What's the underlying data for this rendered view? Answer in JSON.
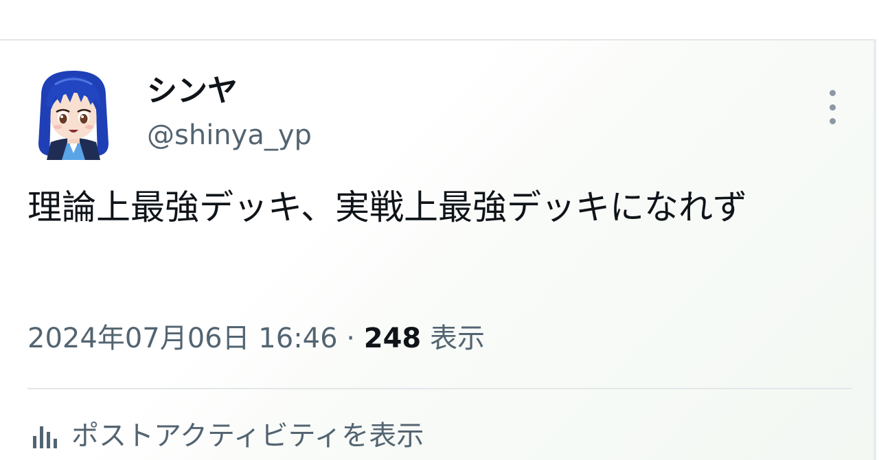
{
  "post": {
    "display_name": "シンヤ",
    "handle": "@shinya_yp",
    "text": "理論上最強デッキ、実戦上最強デッキになれず",
    "timestamp": "2024年07月06日 16:46",
    "separator": " · ",
    "views_count": "248",
    "views_label": "表示",
    "activity_label": "ポストアクティビティを表示"
  },
  "icons": {
    "more": "more-vertical-icon",
    "stats": "bar-chart-icon",
    "avatar": "avatar-anime-girl"
  },
  "colors": {
    "primary_text": "#0f1419",
    "secondary_text": "#536471",
    "divider": "#e3e7ea",
    "hair": "#1e3fb6"
  }
}
